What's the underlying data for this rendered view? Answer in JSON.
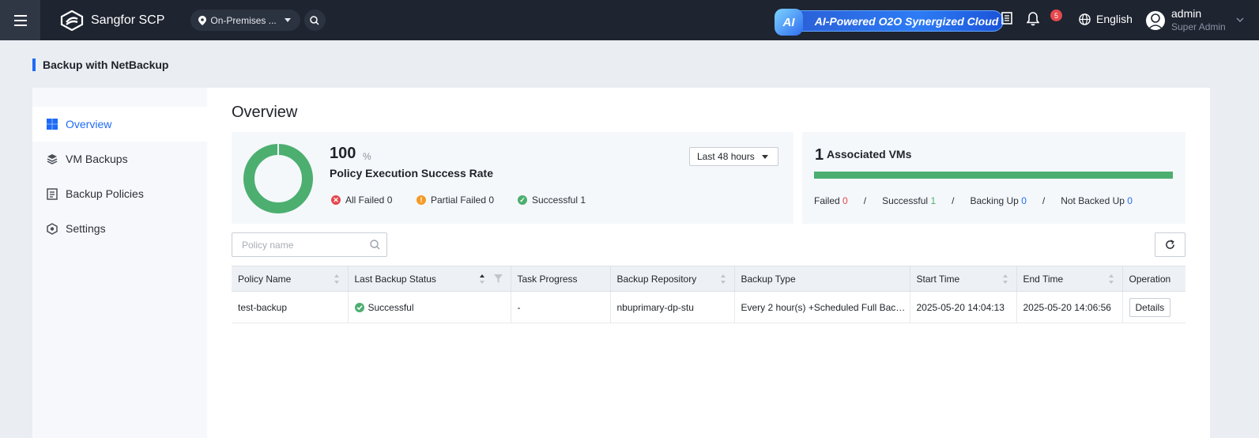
{
  "topbar": {
    "app_name": "Sangfor SCP",
    "region": "On-Premises ...",
    "banner_ai": "AI",
    "banner_text": "AI-Powered O2O Synergized Cloud",
    "notification_count": "5",
    "language": "English",
    "user_name": "admin",
    "user_role": "Super Admin"
  },
  "page": {
    "title": "Backup with NetBackup"
  },
  "sidebar": {
    "items": [
      {
        "label": "Overview",
        "icon": "grid-icon",
        "active": true
      },
      {
        "label": "VM Backups",
        "icon": "layers-icon",
        "active": false
      },
      {
        "label": "Backup Policies",
        "icon": "policy-list-icon",
        "active": false
      },
      {
        "label": "Settings",
        "icon": "hexagon-gear-icon",
        "active": false
      }
    ]
  },
  "overview": {
    "title": "Overview",
    "success_rate": "100",
    "success_rate_unit": "%",
    "success_rate_label": "Policy Execution Success Rate",
    "time_range": "Last 48 hours",
    "legend": {
      "all_failed": "All Failed 0",
      "partial_failed": "Partial Failed 0",
      "successful": "Successful 1"
    },
    "vms": {
      "count": "1",
      "label": "Associated VMs",
      "failed_label": "Failed",
      "failed": "0",
      "successful_label": "Successful",
      "successful": "1",
      "backing_up_label": "Backing Up",
      "backing_up": "0",
      "not_backed_up_label": "Not Backed Up",
      "not_backed_up": "0",
      "separator": "/"
    }
  },
  "search": {
    "placeholder": "Policy name"
  },
  "table": {
    "columns": [
      "Policy Name",
      "Last Backup Status",
      "Task Progress",
      "Backup Repository",
      "Backup Type",
      "Start Time",
      "End Time",
      "Operation"
    ],
    "rows": [
      {
        "policy_name": "test-backup",
        "status": "Successful",
        "progress": "-",
        "repository": "nbuprimary-dp-stu",
        "backup_type": "Every 2 hour(s) +Scheduled Full Backup",
        "start_time": "2025-05-20 14:04:13",
        "end_time": "2025-05-20 14:06:56",
        "operation": "Details"
      }
    ]
  },
  "colors": {
    "accent": "#1f6bf5",
    "success": "#4caf70",
    "danger": "#e5484d",
    "warning": "#f59a23",
    "topbar": "#1e2430"
  }
}
